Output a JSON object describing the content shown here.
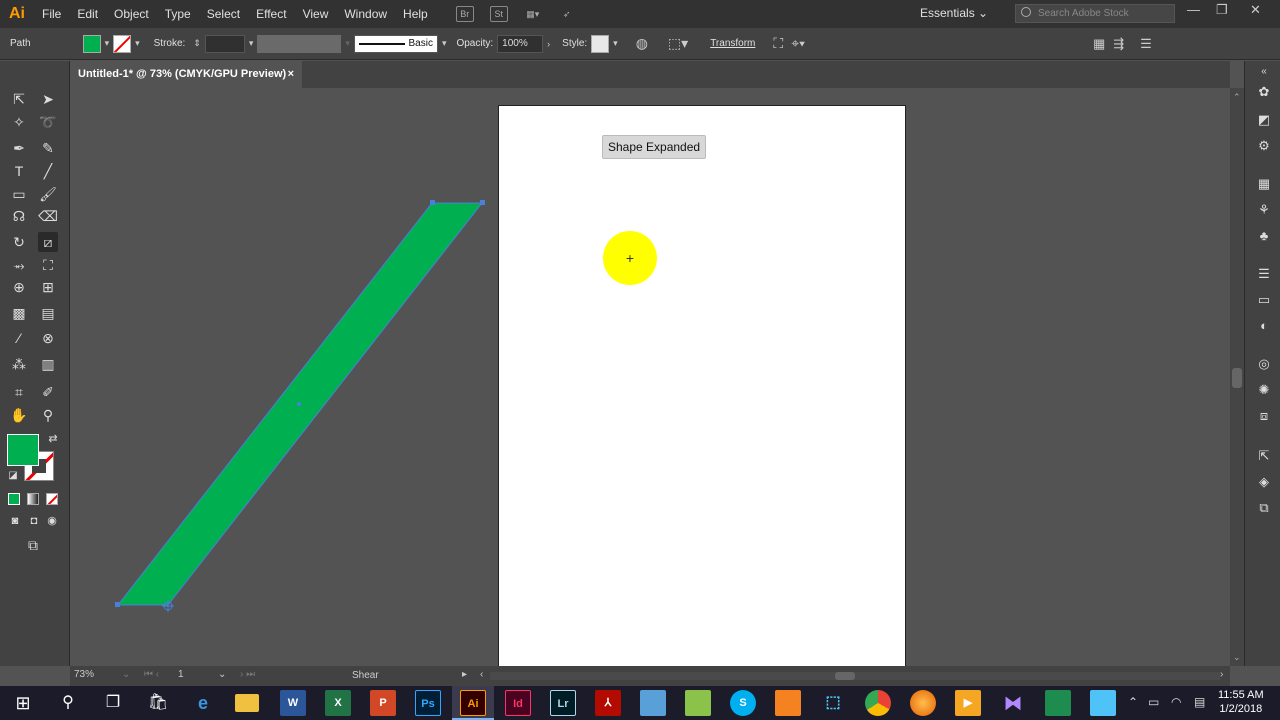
{
  "app": {
    "logo": "Ai"
  },
  "menu": [
    "File",
    "Edit",
    "Object",
    "Type",
    "Select",
    "Effect",
    "View",
    "Window",
    "Help"
  ],
  "menubar_icons": {
    "bridge": "Br",
    "stock": "St"
  },
  "workspace": "Essentials",
  "search": {
    "placeholder": "Search Adobe Stock"
  },
  "control": {
    "selection_label": "Path",
    "fill_color": "#00b050",
    "stroke_label": "Stroke:",
    "brush_label": "Basic",
    "opacity_label": "Opacity:",
    "opacity_value": "100%",
    "style_label": "Style:",
    "transform_label": "Transform"
  },
  "document_tab": {
    "title": "Untitled-1* @ 73% (CMYK/GPU Preview)",
    "close": "×"
  },
  "canvas": {
    "tooltip": "Shape Expanded",
    "shape_fill": "#00b050",
    "selection_color": "#4a7fdc",
    "cursor_highlight": "#ffff00"
  },
  "status": {
    "zoom": "73%",
    "page": "1",
    "current_tool": "Shear"
  },
  "taskbar": {
    "apps": [
      "start",
      "search",
      "task-view",
      "store",
      "edge",
      "file-explorer",
      "word",
      "excel",
      "powerpoint",
      "photoshop",
      "illustrator",
      "indesign",
      "lightroom",
      "acrobat",
      "app",
      "app",
      "skype",
      "app",
      "app",
      "chrome",
      "firefox",
      "app",
      "app",
      "app",
      "app"
    ],
    "time": "11:55 AM",
    "date": "1/2/2018"
  }
}
